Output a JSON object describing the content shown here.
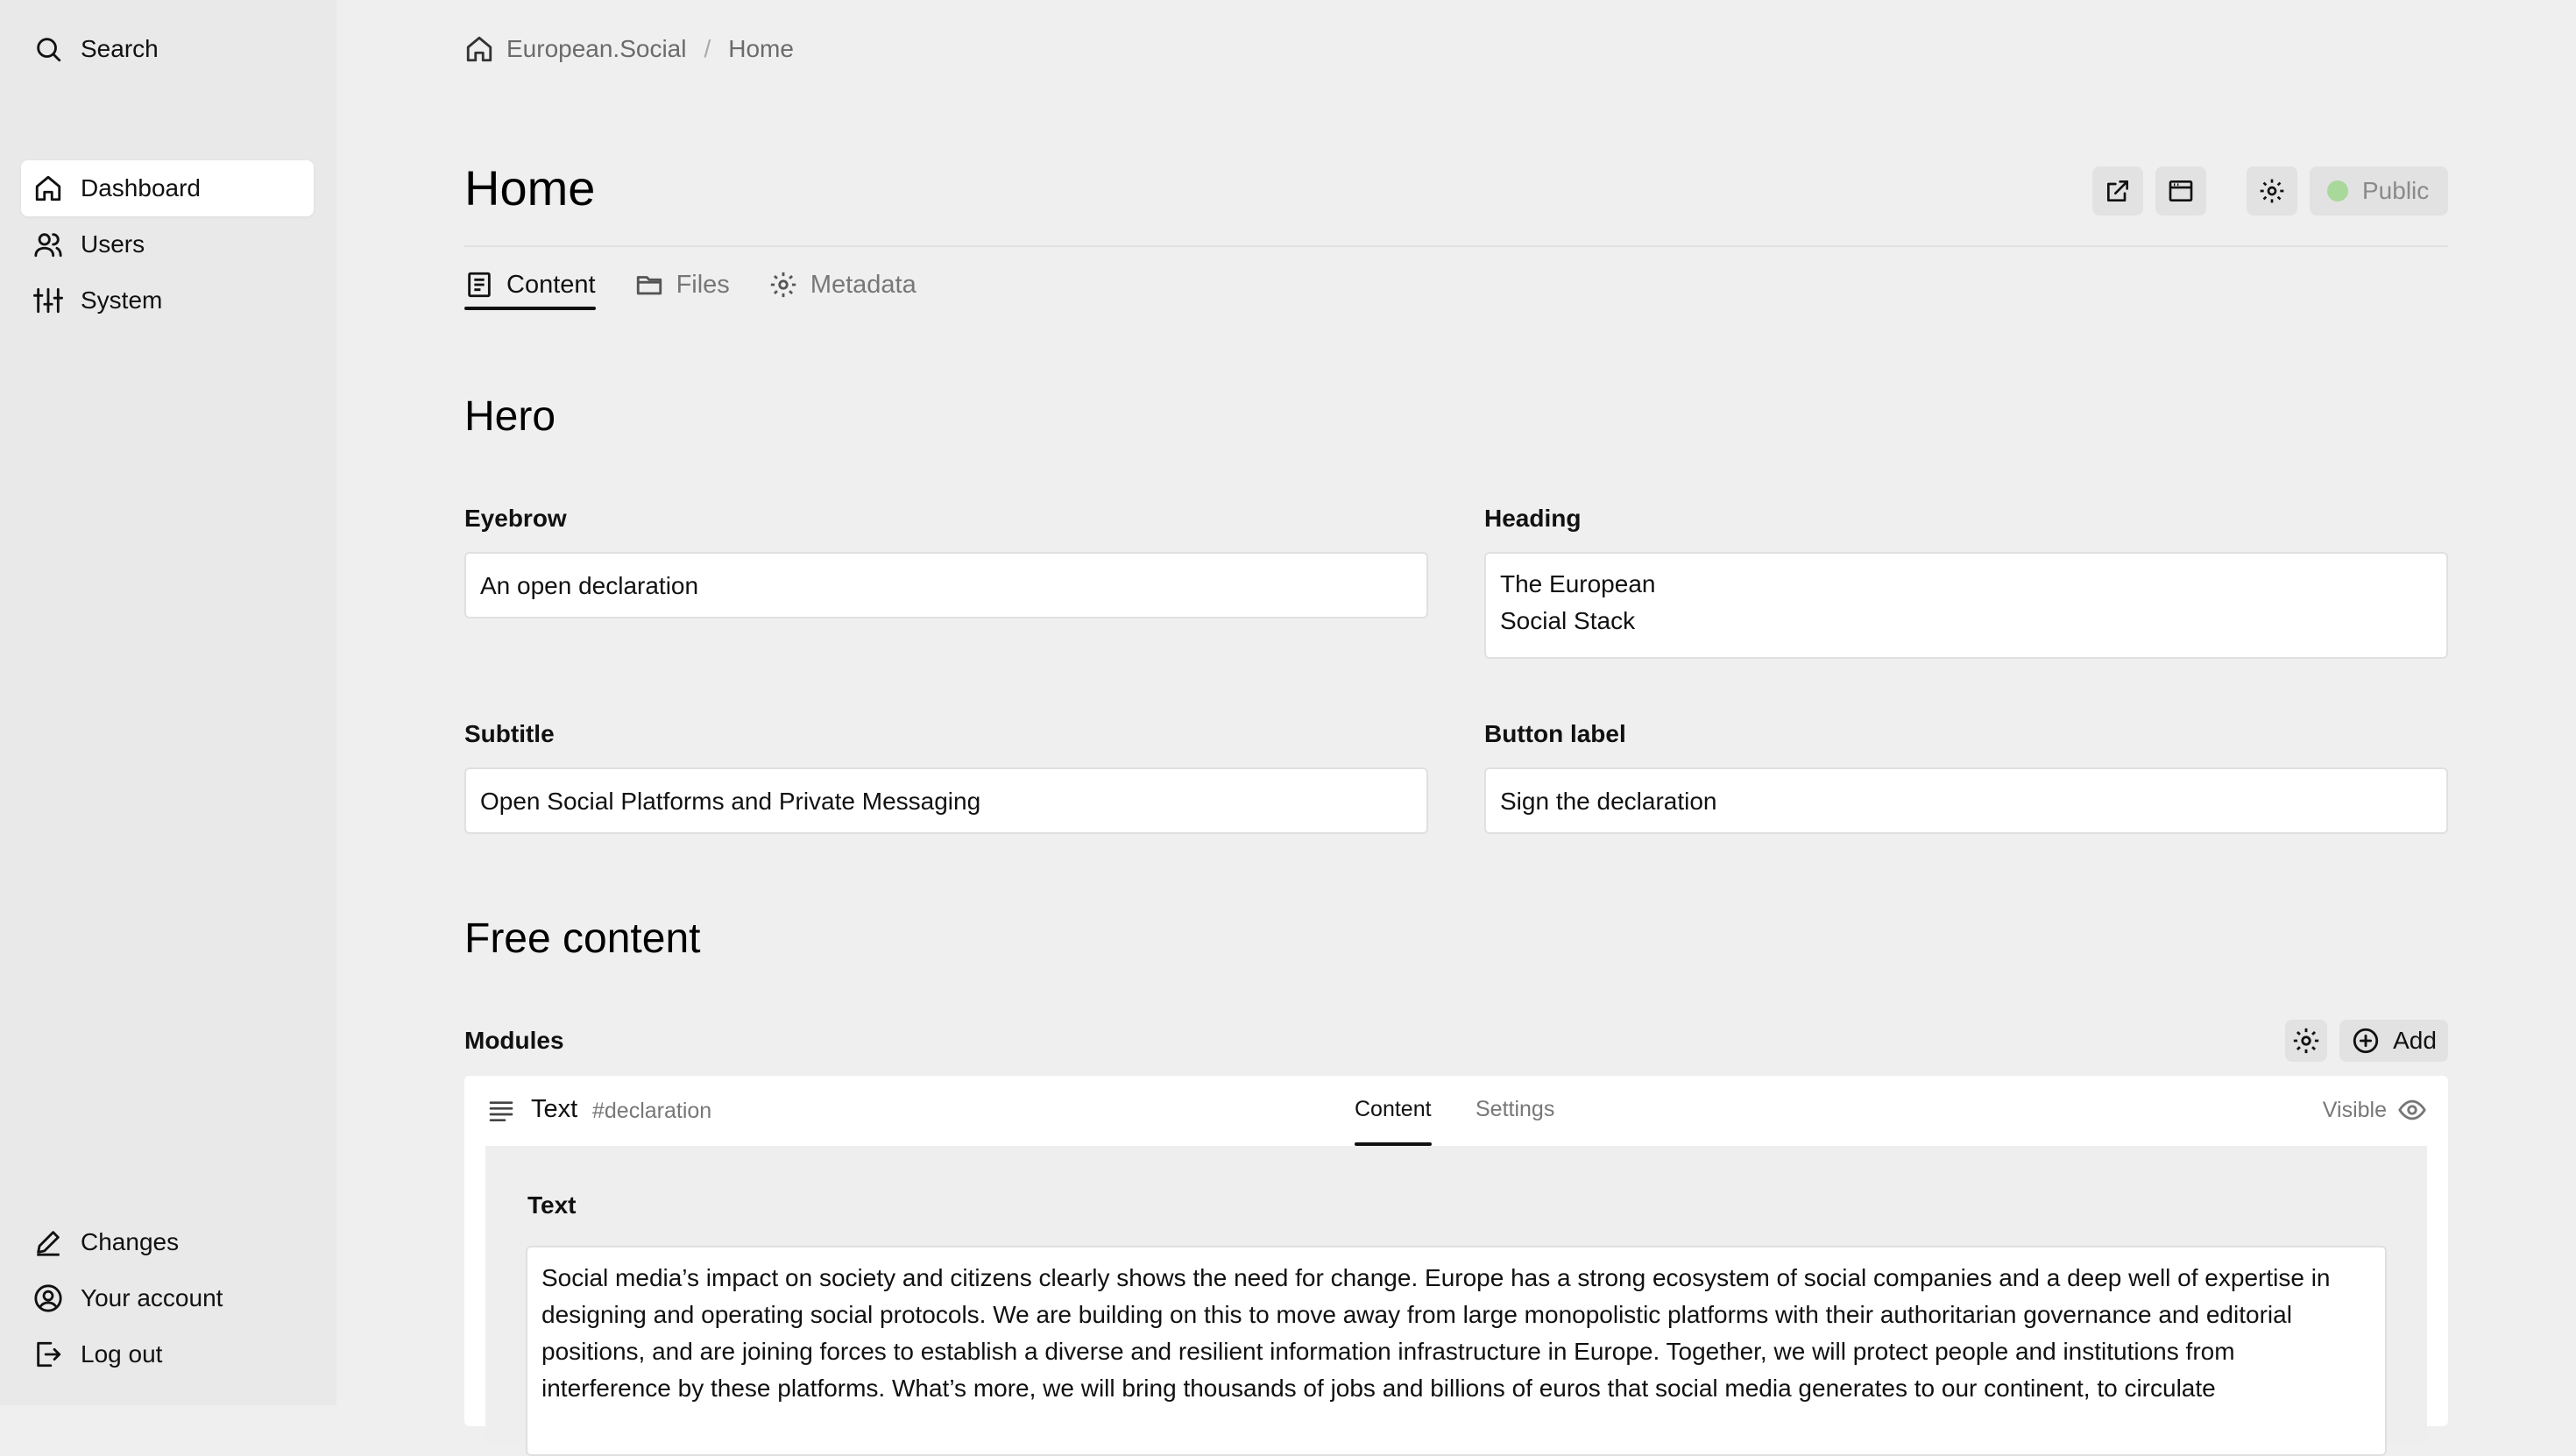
{
  "sidebar": {
    "search_label": "Search",
    "nav": [
      {
        "label": "Dashboard",
        "icon": "home-icon",
        "active": true
      },
      {
        "label": "Users",
        "icon": "users-icon"
      },
      {
        "label": "System",
        "icon": "sliders-icon"
      }
    ],
    "footer": [
      {
        "label": "Changes",
        "icon": "pen-icon"
      },
      {
        "label": "Your account",
        "icon": "user-circle-icon"
      },
      {
        "label": "Log out",
        "icon": "logout-icon"
      }
    ]
  },
  "breadcrumb": {
    "site": "European.Social",
    "separator": "/",
    "current": "Home"
  },
  "page": {
    "title": "Home",
    "status": "Public",
    "status_color": "#a8d89a",
    "tabs": [
      {
        "label": "Content",
        "icon": "document-icon",
        "active": true
      },
      {
        "label": "Files",
        "icon": "folder-icon"
      },
      {
        "label": "Metadata",
        "icon": "gear-icon"
      }
    ]
  },
  "hero": {
    "section_title": "Hero",
    "eyebrow_label": "Eyebrow",
    "eyebrow_value": "An open declaration",
    "heading_label": "Heading",
    "heading_value": "The European\nSocial Stack",
    "subtitle_label": "Subtitle",
    "subtitle_value": "Open Social Platforms and Private Messaging",
    "button_label_label": "Button label",
    "button_label_value": "Sign the declaration"
  },
  "free_content": {
    "section_title": "Free content",
    "modules_label": "Modules",
    "add_label": "Add",
    "module": {
      "type": "Text",
      "anchor": "#declaration",
      "tab_content": "Content",
      "tab_settings": "Settings",
      "visibility": "Visible",
      "text_label": "Text",
      "text_value": "Social media’s impact on society and citizens clearly shows the need for change. Europe has a strong ecosystem of social companies and a deep well of expertise in designing and operating social protocols. We are building on this to move away from large monopolistic platforms with their authoritarian governance and editorial positions, and are joining forces to establish a diverse and resilient information infrastructure in Europe. Together, we will protect people and institutions from interference by these platforms. What’s more, we will bring thousands of jobs and billions of euros that social media generates to our continent, to circulate"
    }
  }
}
